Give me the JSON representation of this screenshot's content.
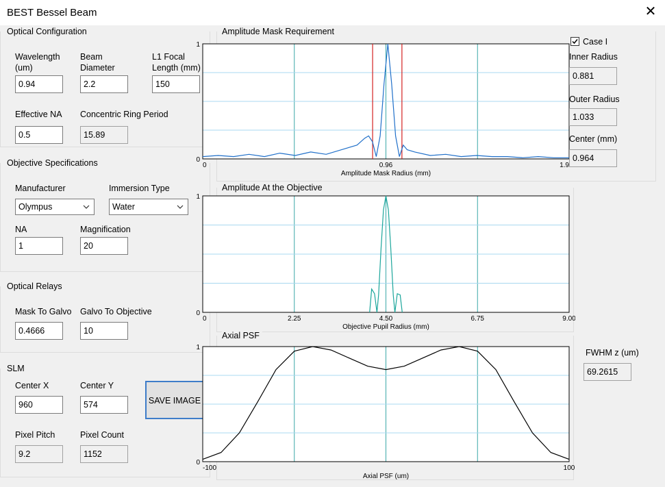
{
  "window": {
    "title": "BEST Bessel Beam",
    "close_glyph": "✕"
  },
  "optical_config": {
    "title": "Optical Configuration",
    "wavelength_label": "Wavelength (um)",
    "wavelength_value": "0.94",
    "beam_diameter_label": "Beam Diameter (mm)",
    "beam_diameter_value": "2.2",
    "l1_focal_label": "L1 Focal Length (mm)",
    "l1_focal_value": "150",
    "effective_na_label": "Effective NA",
    "effective_na_value": "0.5",
    "ring_period_label": "Concentric Ring Period",
    "ring_period_value": "15.89"
  },
  "objective": {
    "title": "Objective Specifications",
    "manufacturer_label": "Manufacturer",
    "manufacturer_value": "Olympus",
    "immersion_label": "Immersion Type",
    "immersion_value": "Water",
    "na_label": "NA",
    "na_value": "1",
    "magnification_label": "Magnification",
    "magnification_value": "20"
  },
  "relays": {
    "title": "Optical Relays",
    "mask_galvo_label": "Mask To Galvo",
    "mask_galvo_value": "0.4666",
    "galvo_objective_label": "Galvo To Objective",
    "galvo_objective_value": "10"
  },
  "slm": {
    "title": "SLM",
    "center_x_label": "Center X",
    "center_x_value": "960",
    "center_y_label": "Center Y",
    "center_y_value": "574",
    "pixel_pitch_label": "Pixel Pitch",
    "pixel_pitch_value": "9.2",
    "pixel_count_label": "Pixel Count",
    "pixel_count_value": "1152",
    "save_button": "SAVE IMAGE"
  },
  "mask_panel": {
    "title": "Amplitude Mask Requirement",
    "case_label": "Case I",
    "case_checked": true,
    "inner_radius_label": "Inner Radius",
    "inner_radius_value": "0.881",
    "outer_radius_label": "Outer Radius",
    "outer_radius_value": "1.033",
    "center_label": "Center (mm)",
    "center_value": "0.964"
  },
  "objective_panel": {
    "title": "Amplitude At the Objective"
  },
  "psf_panel": {
    "title": "Axial PSF",
    "fwhm_label": "FWHM z (um)",
    "fwhm_value": "69.2615"
  },
  "colors": {
    "grid": "#3aa8a8",
    "blue": "#1f6fc9",
    "red": "#d42020",
    "teal": "#1aa59a",
    "black": "#000000"
  },
  "chart_data": [
    {
      "type": "line",
      "title": "Amplitude Mask Requirement",
      "xlabel": "Amplitude Mask Radius (mm)",
      "xlim": [
        0,
        1.9
      ],
      "ylim": [
        0,
        1
      ],
      "xticks": [
        "0",
        "0.96",
        "1.9"
      ],
      "yticks": [
        "0",
        "1"
      ],
      "vlines": [
        0.881,
        1.033
      ],
      "series": [
        {
          "x": [
            0,
            0.08,
            0.16,
            0.24,
            0.32,
            0.4,
            0.48,
            0.56,
            0.64,
            0.72,
            0.8,
            0.84,
            0.86,
            0.88,
            0.9,
            0.92,
            0.94,
            0.96,
            0.98,
            1.0,
            1.02,
            1.04,
            1.06,
            1.1,
            1.18,
            1.26,
            1.34,
            1.42,
            1.5,
            1.58,
            1.66,
            1.74,
            1.82,
            1.9
          ],
          "y": [
            0.02,
            0.03,
            0.02,
            0.04,
            0.02,
            0.05,
            0.03,
            0.06,
            0.04,
            0.08,
            0.12,
            0.18,
            0.2,
            0.15,
            0.02,
            0.2,
            0.65,
            1.0,
            0.65,
            0.2,
            0.02,
            0.12,
            0.08,
            0.06,
            0.03,
            0.04,
            0.02,
            0.03,
            0.02,
            0.02,
            0.01,
            0.02,
            0.01,
            0.01
          ]
        }
      ]
    },
    {
      "type": "line",
      "title": "Amplitude At the Objective",
      "xlabel": "Objective Pupil Radius (mm)",
      "xlim": [
        0,
        9
      ],
      "ylim": [
        0,
        1
      ],
      "xticks": [
        "0",
        "2.25",
        "4.50",
        "6.75",
        "9.00"
      ],
      "yticks": [
        "0",
        "1"
      ],
      "series": [
        {
          "x": [
            4.1,
            4.15,
            4.22,
            4.28,
            4.32,
            4.38,
            4.44,
            4.5,
            4.56,
            4.62,
            4.68,
            4.72,
            4.78,
            4.85,
            4.9
          ],
          "y": [
            0,
            0.2,
            0.16,
            0,
            0.15,
            0.55,
            0.88,
            1.0,
            0.88,
            0.55,
            0.15,
            0,
            0.16,
            0.15,
            0
          ]
        }
      ]
    },
    {
      "type": "line",
      "title": "Axial PSF",
      "xlabel": "Axial PSF (um)",
      "xlim": [
        -100,
        100
      ],
      "ylim": [
        0,
        1
      ],
      "xticks": [
        "-100",
        "100"
      ],
      "yticks": [
        "0",
        "1"
      ],
      "series": [
        {
          "x": [
            -100,
            -90,
            -80,
            -70,
            -60,
            -50,
            -40,
            -30,
            -20,
            -10,
            0,
            10,
            20,
            30,
            40,
            50,
            60,
            70,
            80,
            90,
            100
          ],
          "y": [
            0.02,
            0.08,
            0.25,
            0.52,
            0.8,
            0.96,
            1.0,
            0.97,
            0.9,
            0.83,
            0.8,
            0.83,
            0.9,
            0.97,
            1.0,
            0.96,
            0.8,
            0.52,
            0.25,
            0.08,
            0.02
          ]
        }
      ]
    }
  ]
}
